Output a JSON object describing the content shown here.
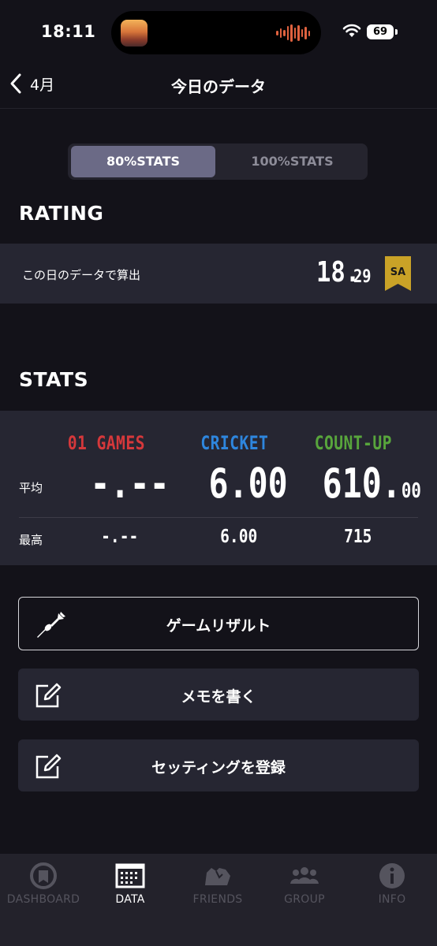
{
  "status_bar": {
    "time": "18:11",
    "battery": "69"
  },
  "header": {
    "back_label": "4月",
    "title": "今日のデータ"
  },
  "segmented": {
    "options": [
      "80%STATS",
      "100%STATS"
    ],
    "selected": "80%STATS"
  },
  "rating": {
    "section_title": "RATING",
    "label": "この日のデータで算出",
    "value_int": "18.",
    "value_dec": "29",
    "rank_badge": "SA",
    "badge_color": "#c9a227"
  },
  "stats": {
    "section_title": "STATS",
    "columns": [
      {
        "name": "01 GAMES",
        "color": "#d5383b",
        "avg_int": "-.--",
        "avg_dec": "",
        "max": "-.--"
      },
      {
        "name": "CRICKET",
        "color": "#2e86de",
        "avg_int": "6.00",
        "avg_dec": "",
        "max": "6.00"
      },
      {
        "name": "COUNT-UP",
        "color": "#58a53c",
        "avg_int": "610.",
        "avg_dec": "00",
        "max": "715"
      }
    ],
    "row_labels": {
      "average": "平均",
      "max": "最高"
    }
  },
  "actions": [
    {
      "label": "ゲームリザルト",
      "icon": "dart-icon"
    },
    {
      "label": "メモを書く",
      "icon": "edit-icon"
    },
    {
      "label": "セッティングを登録",
      "icon": "edit-icon"
    }
  ],
  "tab_bar": {
    "items": [
      {
        "label": "DASHBOARD",
        "icon": "dashboard-icon"
      },
      {
        "label": "DATA",
        "icon": "data-icon"
      },
      {
        "label": "FRIENDS",
        "icon": "friends-icon"
      },
      {
        "label": "GROUP",
        "icon": "group-icon"
      },
      {
        "label": "INFO",
        "icon": "info-icon"
      }
    ],
    "active": "DATA"
  }
}
